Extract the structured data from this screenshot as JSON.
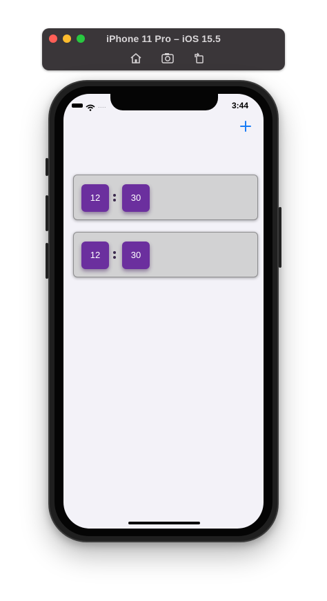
{
  "simulator": {
    "title": "iPhone 11 Pro – iOS 15.5",
    "tools": [
      "home-icon",
      "screenshot-icon",
      "rotate-icon"
    ]
  },
  "status_bar": {
    "time": "3:44",
    "signal_dots": "...."
  },
  "nav": {
    "add_icon": "plus-icon",
    "accent_color": "#1a7cf5"
  },
  "timers": [
    {
      "hours": "12",
      "minutes": "30"
    },
    {
      "hours": "12",
      "minutes": "30"
    }
  ],
  "colors": {
    "tile": "#6b2f9e",
    "card": "#d2d2d3",
    "screen": "#f3f2f8"
  }
}
